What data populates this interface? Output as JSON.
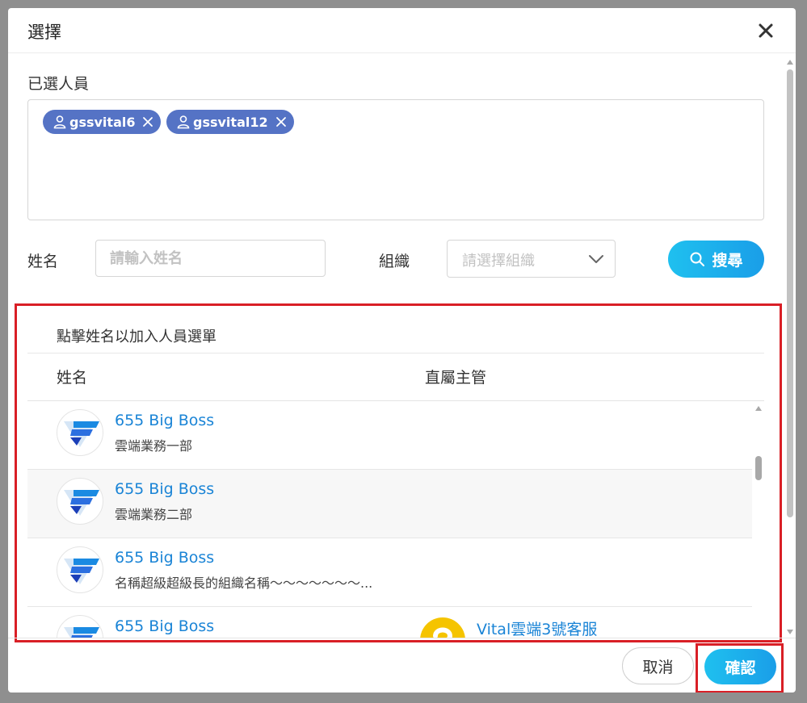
{
  "dialog": {
    "title": "選擇"
  },
  "selected": {
    "label": "已選人員",
    "chips": [
      {
        "name": "gssvital6"
      },
      {
        "name": "gssvital12"
      }
    ]
  },
  "filters": {
    "name_label": "姓名",
    "name_placeholder": "請輸入姓名",
    "org_label": "組織",
    "org_placeholder": "請選擇組織",
    "search_label": "搜尋"
  },
  "list": {
    "hint": "點擊姓名以加入人員選單",
    "columns": {
      "name": "姓名",
      "manager": "直屬主管"
    },
    "rows": [
      {
        "name": "655 Big Boss",
        "org": "雲端業務一部",
        "manager": ""
      },
      {
        "name": "655 Big Boss",
        "org": "雲端業務二部",
        "manager": ""
      },
      {
        "name": "655 Big Boss",
        "org": "名稱超級超級長的組織名稱～～～～～～～...",
        "manager": ""
      },
      {
        "name": "655 Big Boss",
        "org": "",
        "manager": "Vital雲端3號客服"
      }
    ]
  },
  "footer": {
    "cancel_label": "取消",
    "confirm_label": "確認"
  },
  "colors": {
    "chip": "#5573c5",
    "accent": "#1a9ee8",
    "link": "#1a84d6",
    "highlight": "#d91f26"
  },
  "icons": {
    "close": "close-icon",
    "user": "user-icon",
    "chip_remove": "x-icon",
    "dropdown": "chevron-down-icon",
    "search": "search-icon",
    "company_logo": "company-logo",
    "manager_avatar": "avatar"
  }
}
